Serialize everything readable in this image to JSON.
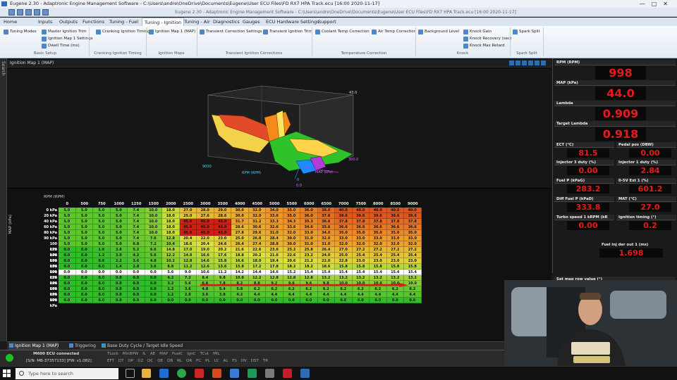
{
  "window": {
    "title": "Eugene 2.30 - Adaptronic Engine Management Software - C:\\Users\\andre\\OneDrive\\Documents\\Eugene\\User ECU Files\\FD RX7 HPA Track.ecu    [16:00 2020-11-17]",
    "center_title": "Eugene 2.30 - Adaptronic Engine Management Software - C:\\Users\\andre\\OneDrive\\Documents\\Eugene\\User ECU Files\\FD RX7 HPA Track.ecu [16:00 2020-11-17]",
    "controls": [
      "—",
      "□",
      "✕"
    ]
  },
  "menu": {
    "items": [
      "Home",
      "Inputs",
      "Outputs",
      "Functions",
      "Tuning - Fuel",
      "Tuning - Ignition",
      "Tuning - Air",
      "Diagnostics",
      "Gauges",
      "ECU Hardware Settings",
      "Support"
    ],
    "active": "Tuning - Ignition"
  },
  "ribbon": {
    "buttons": [
      "Tuning Modes",
      "Master Ignition Trim",
      "Ignition Map 1 Settings",
      "Dwell Time (ms)",
      "Cranking Ignition Timing",
      "Ignition Map 1 (MAP)",
      "Transient Correction Settings",
      "Transient Ignition Trim",
      "Coolant Temp Correction",
      "Air Temp Correction",
      "Background Level",
      "Knock Gain",
      "Knock Recovery (sec)",
      "Knock Max Retard",
      "Spark Split"
    ],
    "groups": [
      "Basic Setup",
      "Cranking Ignition Timing",
      "Ignition Maps",
      "Transient Ignition Corrections",
      "Temperature Correction",
      "Knock",
      "Spark Split"
    ]
  },
  "sidebar": {
    "label": "Search"
  },
  "panel": {
    "title": "Ignition Map 1 (MAP)"
  },
  "surface": {
    "max_label": "43.0",
    "rpm_axis": "RPM (RPM)",
    "rpm_min": "9000",
    "map_axis": "MAP (kPa)",
    "map_max": "300.0",
    "zero": "0",
    "map_min": "0.0"
  },
  "table": {
    "x_label": "RPM (RPM)",
    "y_label": "MAP (kPa)",
    "columns": [
      "0",
      "500",
      "750",
      "1000",
      "1250",
      "1500",
      "2000",
      "2500",
      "3000",
      "3500",
      "4000",
      "4500",
      "5000",
      "5500",
      "6000",
      "6500",
      "7000",
      "7500",
      "8000",
      "8500",
      "9000"
    ],
    "rows": [
      {
        "label": "0 kPa",
        "values": [
          "5.0",
          "5.0",
          "5.0",
          "5.0",
          "7.4",
          "10.0",
          "18.0",
          "27.0",
          "28.0",
          "29.0",
          "30.0",
          "32.0",
          "34.0",
          "35.0",
          "36.0",
          "38.0",
          "40.0",
          "40.0",
          "40.0",
          "40.0",
          "40.0"
        ]
      },
      {
        "label": "20 kPa",
        "values": [
          "5.0",
          "5.0",
          "5.0",
          "5.0",
          "7.4",
          "10.0",
          "18.0",
          "25.0",
          "27.6",
          "28.6",
          "30.0",
          "32.0",
          "33.6",
          "35.0",
          "36.0",
          "37.6",
          "39.6",
          "39.6",
          "39.6",
          "39.6",
          "39.6"
        ]
      },
      {
        "label": "40 kPa",
        "values": [
          "5.0",
          "5.0",
          "5.0",
          "5.0",
          "7.4",
          "10.0",
          "18.0",
          "45.0",
          "45.0",
          "45.0",
          "31.7",
          "31.2",
          "33.3",
          "34.3",
          "35.3",
          "36.6",
          "37.8",
          "37.8",
          "37.8",
          "37.8",
          "37.8"
        ]
      },
      {
        "label": "60 kPa",
        "values": [
          "5.0",
          "5.0",
          "5.0",
          "5.0",
          "7.4",
          "10.0",
          "18.0",
          "45.0",
          "45.0",
          "45.0",
          "28.6",
          "30.6",
          "32.6",
          "33.6",
          "34.6",
          "35.6",
          "36.6",
          "36.6",
          "36.6",
          "36.6",
          "36.6"
        ]
      },
      {
        "label": "80 kPa",
        "values": [
          "5.0",
          "5.0",
          "5.0",
          "5.0",
          "7.4",
          "10.0",
          "18.0",
          "45.0",
          "45.0",
          "45.0",
          "27.8",
          "29.6",
          "31.0",
          "32.0",
          "33.0",
          "34.0",
          "35.0",
          "35.0",
          "35.0",
          "35.0",
          "35.0"
        ]
      },
      {
        "label": "90 kPa",
        "values": [
          "5.0",
          "5.0",
          "5.0",
          "5.0",
          "7.4",
          "7.6",
          "12.8",
          "20.4",
          "22.0",
          "23.0",
          "25.0",
          "26.8",
          "28.4",
          "30.0",
          "31.0",
          "32.0",
          "33.0",
          "33.0",
          "33.0",
          "33.0",
          "33.0"
        ]
      },
      {
        "label": "100 kPa",
        "values": [
          "5.0",
          "5.0",
          "5.0",
          "5.0",
          "6.8",
          "7.2",
          "10.4",
          "18.6",
          "20.4",
          "24.6",
          "26.4",
          "27.4",
          "28.8",
          "30.0",
          "31.0",
          "31.0",
          "32.0",
          "32.0",
          "32.0",
          "32.0",
          "32.0"
        ]
      },
      {
        "label": "120 kPa",
        "values": [
          "0.0",
          "0.0",
          "1.6",
          "3.8",
          "5.2",
          "6.6",
          "14.8",
          "17.0",
          "19.0",
          "20.2",
          "21.6",
          "22.6",
          "23.6",
          "25.2",
          "25.8",
          "26.4",
          "27.0",
          "27.2",
          "27.2",
          "27.2",
          "27.2"
        ]
      },
      {
        "label": "140 kPa",
        "values": [
          "0.0",
          "0.0",
          "1.2",
          "3.0",
          "4.2",
          "5.6",
          "12.2",
          "14.8",
          "16.6",
          "17.6",
          "18.8",
          "20.2",
          "21.6",
          "22.6",
          "23.2",
          "24.0",
          "25.0",
          "25.4",
          "25.4",
          "25.4",
          "25.4"
        ]
      },
      {
        "label": "160 kPa",
        "values": [
          "0.0",
          "0.0",
          "0.6",
          "2.2",
          "3.6",
          "4.8",
          "10.2",
          "12.8",
          "14.6",
          "15.8",
          "16.6",
          "18.0",
          "19.4",
          "20.6",
          "21.2",
          "22.0",
          "22.8",
          "23.0",
          "23.0",
          "23.0",
          "23.0"
        ]
      },
      {
        "label": "180 kPa",
        "values": [
          "0.0",
          "0.0",
          "0.0",
          "1.4",
          "2.8",
          "3.6",
          "8.8",
          "11.2",
          "12.6",
          "13.6",
          "15.8",
          "17.2",
          "17.8",
          "18.2",
          "18.2",
          "18.6",
          "15.8",
          "15.8",
          "15.8",
          "15.8",
          "15.8"
        ]
      },
      {
        "label": "200 kPa",
        "values": [
          "0.0",
          "0.0",
          "0.0",
          "0.0",
          "0.0",
          "0.0",
          "5.6",
          "9.0",
          "10.6",
          "11.2",
          "14.2",
          "14.4",
          "14.6",
          "15.2",
          "15.4",
          "15.4",
          "15.4",
          "15.4",
          "15.4",
          "15.4",
          "15.4"
        ]
      },
      {
        "label": "220 kPa",
        "values": [
          "0.0",
          "0.0",
          "0.0",
          "0.0",
          "0.0",
          "0.0",
          "4.2",
          "7.2",
          "8.4",
          "9.8",
          "10.8",
          "12.2",
          "12.8",
          "12.8",
          "12.8",
          "13.2",
          "13.2",
          "13.2",
          "13.2",
          "13.2",
          "13.2"
        ]
      },
      {
        "label": "240 kPa",
        "values": [
          "0.0",
          "0.0",
          "0.0",
          "0.0",
          "0.0",
          "0.0",
          "3.2",
          "5.6",
          "6.6",
          "7.8",
          "8.2",
          "8.8",
          "9.2",
          "9.6",
          "9.6",
          "9.8",
          "10.0",
          "10.0",
          "10.0",
          "10.0",
          "10.0"
        ]
      },
      {
        "label": "260 kPa",
        "values": [
          "0.0",
          "0.0",
          "0.0",
          "0.0",
          "0.0",
          "0.0",
          "2.2",
          "3.6",
          "4.8",
          "5.4",
          "5.8",
          "6.2",
          "6.2",
          "6.2",
          "6.2",
          "6.2",
          "6.2",
          "6.2",
          "6.2",
          "6.2",
          "6.2"
        ]
      },
      {
        "label": "280 kPa",
        "values": [
          "0.0",
          "0.0",
          "0.0",
          "0.0",
          "0.0",
          "0.0",
          "1.2",
          "2.8",
          "3.6",
          "3.8",
          "4.2",
          "4.4",
          "4.4",
          "4.4",
          "4.4",
          "4.4",
          "4.4",
          "4.4",
          "4.4",
          "4.4",
          "4.4"
        ]
      },
      {
        "label": "300 kPa",
        "values": [
          "0.0",
          "0.0",
          "0.0",
          "0.0",
          "0.0",
          "0.0",
          "0.0",
          "0.0",
          "0.0",
          "0.0",
          "0.0",
          "0.0",
          "0.0",
          "0.0",
          "0.0",
          "0.0",
          "0.0",
          "0.0",
          "0.0",
          "0.0",
          "0.0"
        ]
      }
    ],
    "highlight_row": 11
  },
  "bottom_tabs": [
    "Ignition Map 1 (MAP)",
    "Triggering",
    "Base Duty Cycle / Target Idle Speed"
  ],
  "status": {
    "ecu": "M600 ECU connected",
    "serial": "[S/N: MB-37357133] [FW: v1.082]",
    "flags1": [
      "TLock",
      "MinBPW",
      "IL",
      "AE",
      "MAP",
      "FuelC",
      "IgnC",
      "TCut",
      "MIL"
    ],
    "flags2": [
      "EFT",
      "DT",
      "OP",
      "O2",
      "OC",
      "OE",
      "OB",
      "RL",
      "OR",
      "FC",
      "PL",
      "LC",
      "AL",
      "FS",
      "DV",
      "DST",
      "TR"
    ]
  },
  "taskbar": {
    "search_placeholder": "Type here to search"
  },
  "gauges": {
    "rpm": {
      "label": "RPM (RPM)",
      "value": "998"
    },
    "map": {
      "label": "MAP (kPa)",
      "value": "44.0"
    },
    "lambda": {
      "label": "Lambda",
      "value": "0.909"
    },
    "target_lambda": {
      "label": "Target Lambda",
      "value": "0.918"
    },
    "ect": {
      "label": "ECT (°C)",
      "value": "81.5"
    },
    "pedal": {
      "label": "Pedal pos (DBW)",
      "value": "0.00"
    },
    "inj3": {
      "label": "Injector 3 duty (%)",
      "value": "0.00"
    },
    "inj1": {
      "label": "Injector 1 duty (%)",
      "value": "2.84"
    },
    "fuelp": {
      "label": "Fuel P (kPaG)",
      "value": "283.2"
    },
    "ext1": {
      "label": "0-5V Ext 1 (%)",
      "value": "601.2"
    },
    "difffuel": {
      "label": "Diff Fuel P (kPaD)",
      "value": "333.8"
    },
    "mat": {
      "label": "MAT (°C)",
      "value": "27.0"
    },
    "turbo": {
      "label": "Turbo speed 1 kRPM (kR",
      "value": "0.00"
    },
    "igntiming": {
      "label": "Ignition timing (°)",
      "value": "0.2"
    },
    "fuelinj": {
      "label": "Fuel inj der out 1 (ms)",
      "value": "1.698"
    },
    "setvalue": {
      "label": "Set map row value (°)"
    }
  },
  "colors": {
    "accent": "#2f6db3",
    "gauge_red": "#e8191b",
    "connected": "#19c21f"
  }
}
